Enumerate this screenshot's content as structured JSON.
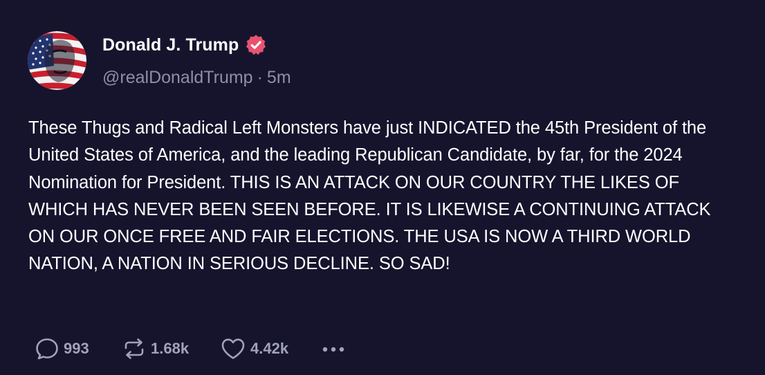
{
  "post": {
    "author": {
      "display_name": "Donald J. Trump",
      "handle": "@realDonaldTrump",
      "separator": "·",
      "time_ago": "5m",
      "verified": true,
      "verified_badge_color": "#e8536f",
      "avatar_icon": "flag-portrait-avatar"
    },
    "text": "These Thugs and Radical Left Monsters have just INDICATED the 45th President of the United States of America, and the leading Republican Candidate, by far, for the 2024 Nomination for President. THIS IS AN ATTACK ON OUR COUNTRY THE LIKES OF WHICH HAS NEVER BEEN SEEN BEFORE. IT IS LIKEWISE A CONTINUING ATTACK ON OUR ONCE FREE AND FAIR ELECTIONS. THE USA IS NOW A THIRD WORLD NATION, A NATION IN SERIOUS DECLINE. SO SAD!",
    "actions": {
      "reply": {
        "icon": "reply-bubble-icon",
        "count": "993"
      },
      "repost": {
        "icon": "repost-icon",
        "count": "1.68k"
      },
      "like": {
        "icon": "heart-icon",
        "count": "4.42k"
      },
      "more": {
        "icon": "more-dots-icon"
      }
    }
  },
  "theme": {
    "background": "#16142d",
    "text_primary": "#ffffff",
    "text_secondary": "#8f8ea8",
    "action_color": "#a2a1bb"
  }
}
